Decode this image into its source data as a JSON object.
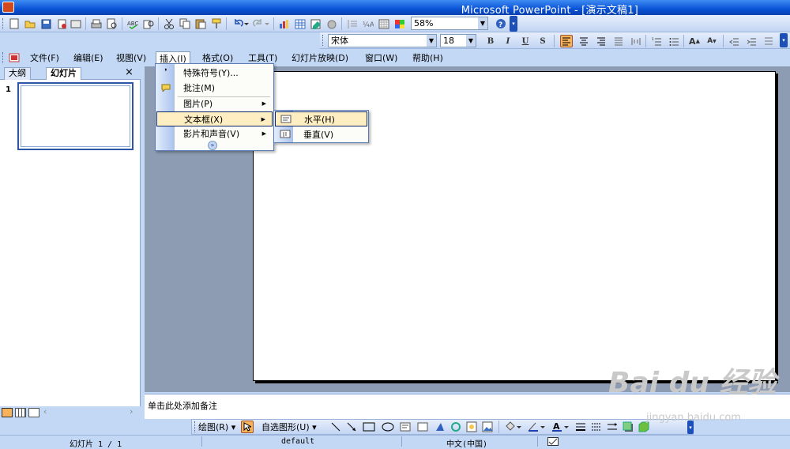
{
  "window": {
    "title": "Microsoft PowerPoint - [演示文稿1]"
  },
  "toolbar": {
    "zoom": "58%",
    "font_name": "宋体",
    "font_size": "18",
    "bold": "B",
    "italic": "I",
    "underline": "U",
    "shadow": "S",
    "increase_font": "A",
    "decrease_font": "A",
    "help": "?"
  },
  "menubar": [
    "文件(F)",
    "编辑(E)",
    "视图(V)",
    "插入(I)",
    "格式(O)",
    "工具(T)",
    "幻灯片放映(D)",
    "窗口(W)",
    "帮助(H)"
  ],
  "left_pane": {
    "tabs": [
      "大纲",
      "幻灯片"
    ],
    "close": "×",
    "slide_number": "1"
  },
  "insert_menu": {
    "items": [
      "特殊符号(Y)...",
      "批注(M)",
      "图片(P)",
      "文本框(X)",
      "影片和声音(V)"
    ],
    "more": "»"
  },
  "textbox_submenu": {
    "items": [
      "水平(H)",
      "垂直(V)"
    ]
  },
  "notes": {
    "placeholder": "单击此处添加备注"
  },
  "draw_toolbar": {
    "draw_label": "绘图(R)",
    "autoshapes_label": "自选图形(U)"
  },
  "statusbar": {
    "slide_info": "幻灯片 1 / 1",
    "design": "default",
    "language": "中文(中国)"
  },
  "watermark": {
    "brand": "Bai du 经验",
    "url": "jingyan.baidu.com"
  }
}
